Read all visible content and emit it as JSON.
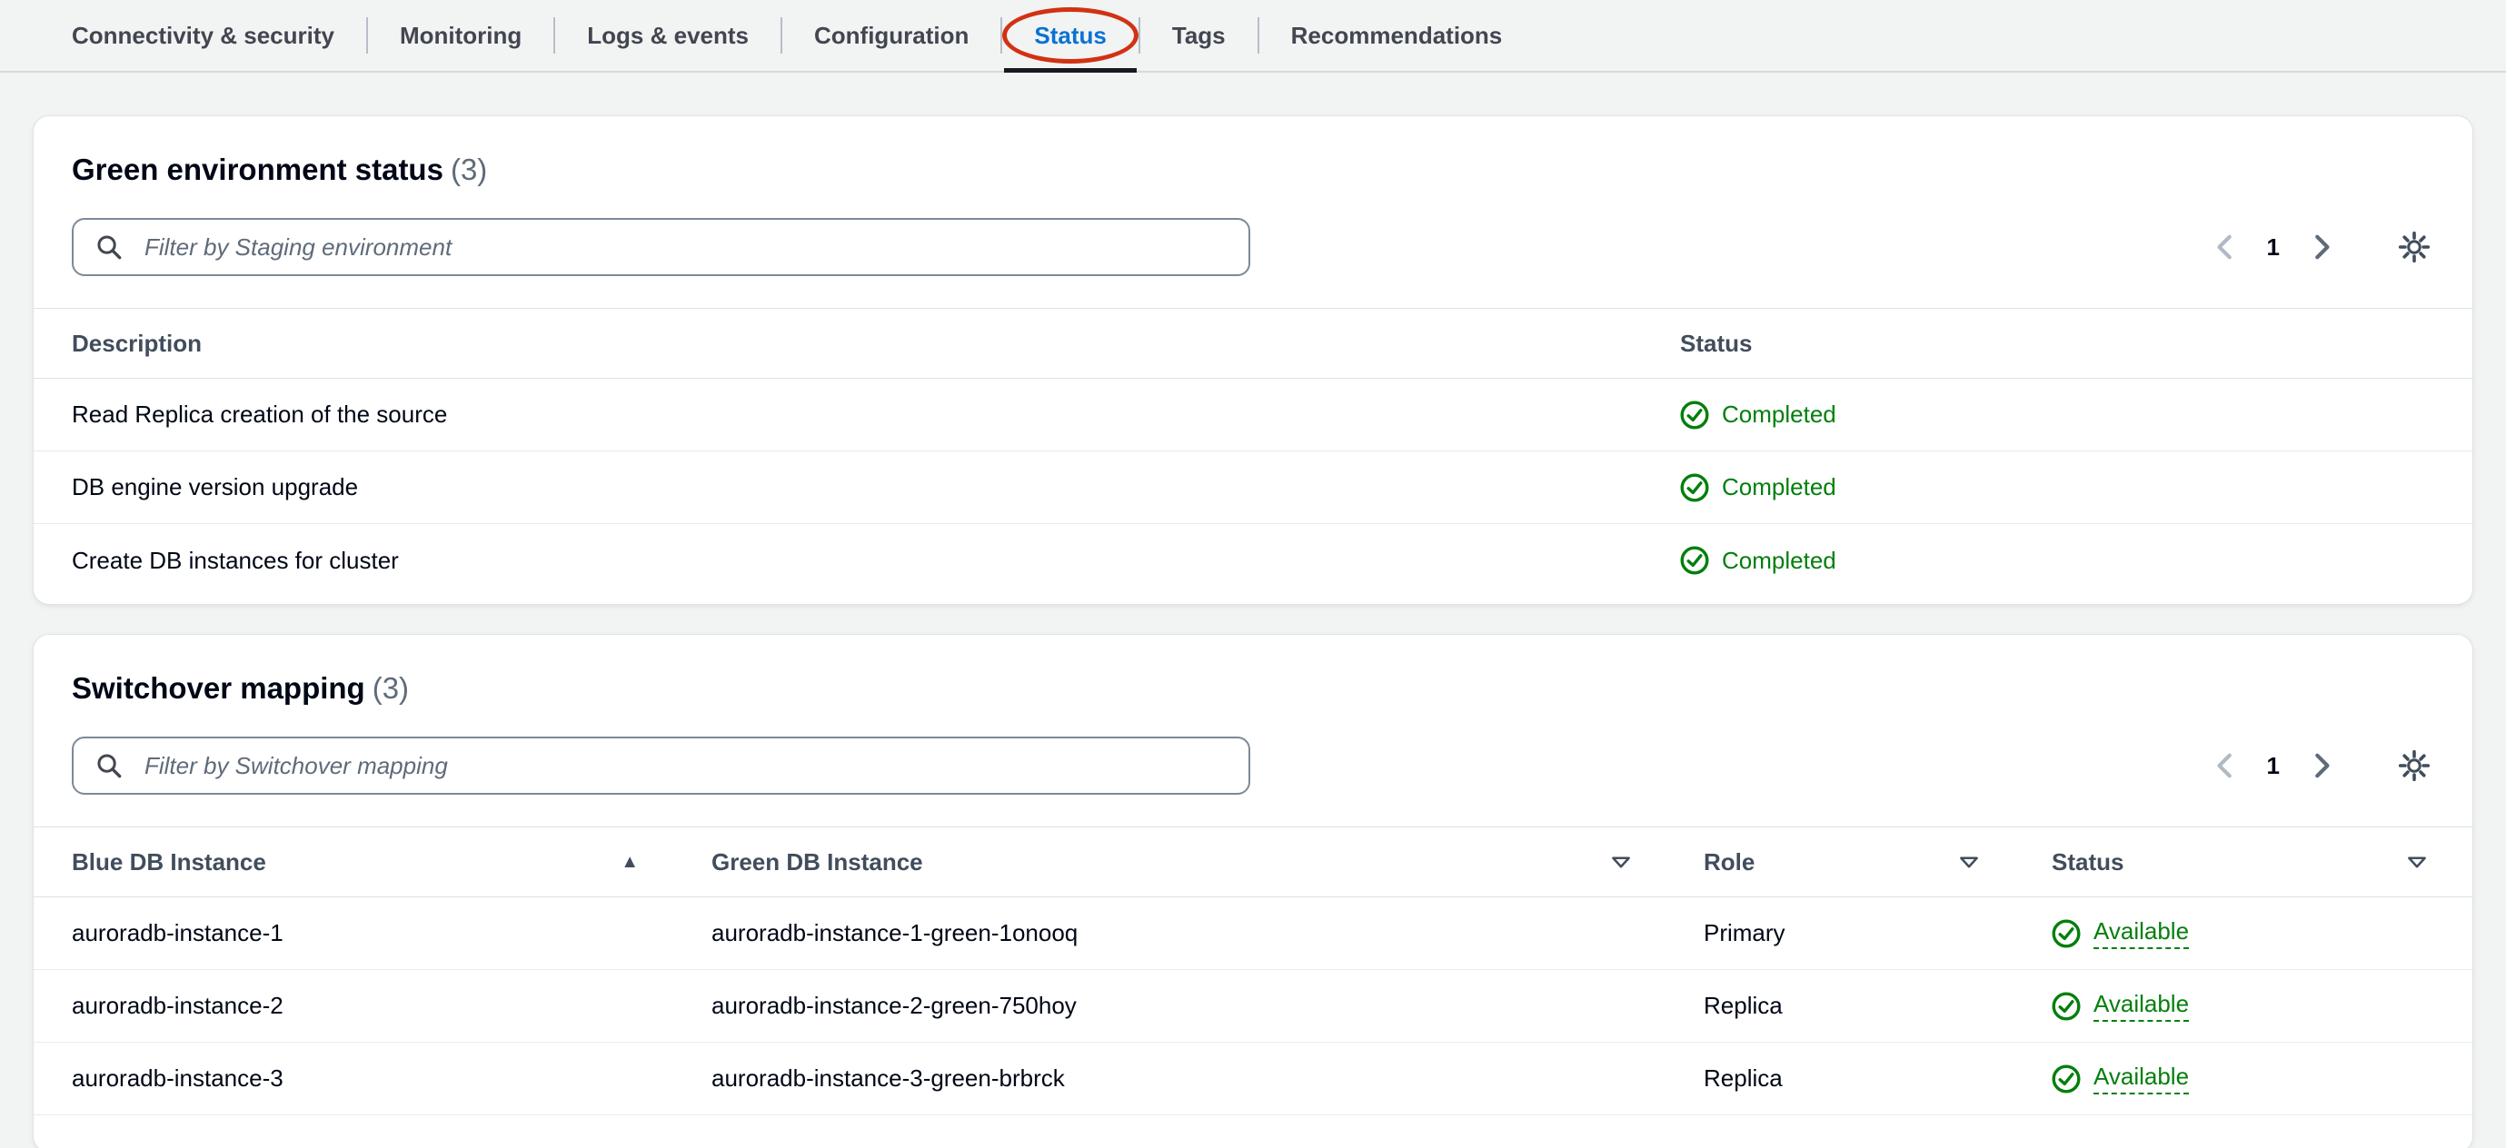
{
  "tabs": [
    {
      "label": "Connectivity & security",
      "selected": false
    },
    {
      "label": "Monitoring",
      "selected": false
    },
    {
      "label": "Logs & events",
      "selected": false
    },
    {
      "label": "Configuration",
      "selected": false
    },
    {
      "label": "Status",
      "selected": true,
      "annotated": true
    },
    {
      "label": "Tags",
      "selected": false
    },
    {
      "label": "Recommendations",
      "selected": false
    }
  ],
  "green_status_card": {
    "title": "Green environment status",
    "count": "(3)",
    "filter_placeholder": "Filter by Staging environment",
    "page_number": "1",
    "columns": [
      "Description",
      "Status"
    ],
    "rows": [
      {
        "description": "Read Replica creation of the source",
        "status": "Completed"
      },
      {
        "description": "DB engine version upgrade",
        "status": "Completed"
      },
      {
        "description": "Create DB instances for cluster",
        "status": "Completed"
      }
    ]
  },
  "switchover_card": {
    "title": "Switchover mapping",
    "count": "(3)",
    "filter_placeholder": "Filter by Switchover mapping",
    "page_number": "1",
    "columns": [
      "Blue DB Instance",
      "Green DB Instance",
      "Role",
      "Status"
    ],
    "rows": [
      {
        "blue": "auroradb-instance-1",
        "green": "auroradb-instance-1-green-1onooq",
        "role": "Primary",
        "status": "Available"
      },
      {
        "blue": "auroradb-instance-2",
        "green": "auroradb-instance-2-green-750hoy",
        "role": "Replica",
        "status": "Available"
      },
      {
        "blue": "auroradb-instance-3",
        "green": "auroradb-instance-3-green-brbrck",
        "role": "Replica",
        "status": "Available"
      }
    ]
  },
  "icons": {
    "search": "magnifier",
    "settings": "gear",
    "previous_page": "chevron-left",
    "next_page": "chevron-right",
    "sort_ascending": "▲",
    "sortable": "caret-down-outline",
    "status_success": "check-circle"
  },
  "colors": {
    "success_green": "#037f0c",
    "tab_active_blue": "#0972d3",
    "annotation_red": "#d13212"
  }
}
